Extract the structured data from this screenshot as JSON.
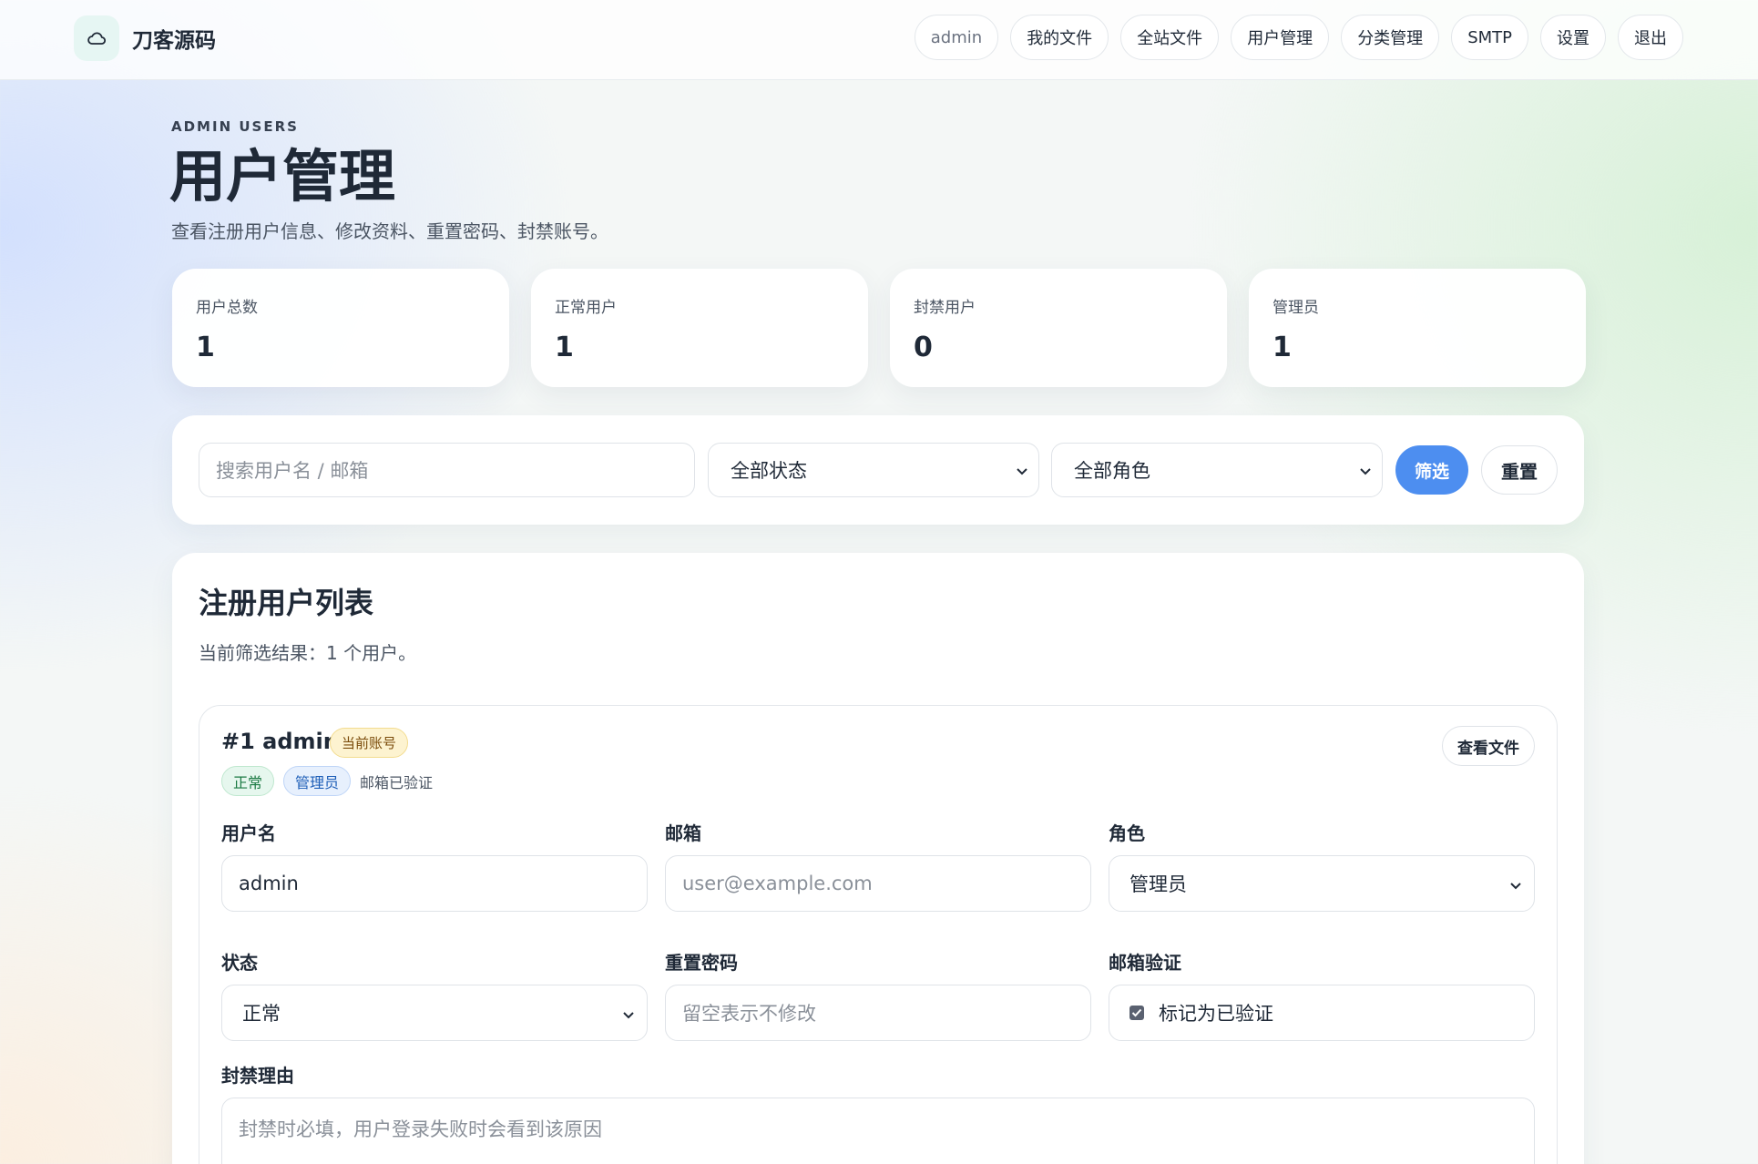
{
  "app": {
    "brand": "刀客源码",
    "logo_icon": "cloud-icon"
  },
  "nav": {
    "items": [
      {
        "label": "admin"
      },
      {
        "label": "我的文件"
      },
      {
        "label": "全站文件"
      },
      {
        "label": "用户管理"
      },
      {
        "label": "分类管理"
      },
      {
        "label": "SMTP"
      },
      {
        "label": "设置"
      },
      {
        "label": "退出"
      }
    ]
  },
  "header": {
    "eyebrow": "ADMIN USERS",
    "title": "用户管理",
    "subtitle": "查看注册用户信息、修改资料、重置密码、封禁账号。"
  },
  "stats": [
    {
      "label": "用户总数",
      "value": "1"
    },
    {
      "label": "正常用户",
      "value": "1"
    },
    {
      "label": "封禁用户",
      "value": "0"
    },
    {
      "label": "管理员",
      "value": "1"
    }
  ],
  "filters": {
    "search_placeholder": "搜索用户名 / 邮箱",
    "status_selected": "全部状态",
    "role_selected": "全部角色",
    "filter_button": "筛选",
    "reset_button": "重置"
  },
  "list": {
    "title": "注册用户列表",
    "summary": "当前筛选结果：1 个用户。"
  },
  "user": {
    "title": "#1 admin",
    "current_badge": "当前账号",
    "status_badge": "正常",
    "role_badge": "管理员",
    "email_verified_text": "邮箱已验证",
    "view_files_button": "查看文件",
    "fields": {
      "username_label": "用户名",
      "username_value": "admin",
      "email_label": "邮箱",
      "email_placeholder": "user@example.com",
      "role_label": "角色",
      "role_value": "管理员",
      "status_label": "状态",
      "status_value": "正常",
      "password_label": "重置密码",
      "password_placeholder": "留空表示不修改",
      "verify_label": "邮箱验证",
      "verify_checkbox_label": "标记为已验证",
      "verify_checked": true,
      "ban_reason_label": "封禁理由",
      "ban_reason_placeholder": "封禁时必填，用户登录失败时会看到该原因"
    }
  },
  "colors": {
    "accent": "#4d8ef0",
    "text": "#1f2937",
    "success": "#1b7a43",
    "info": "#1f5fb8",
    "warning": "#7a4b0a"
  }
}
